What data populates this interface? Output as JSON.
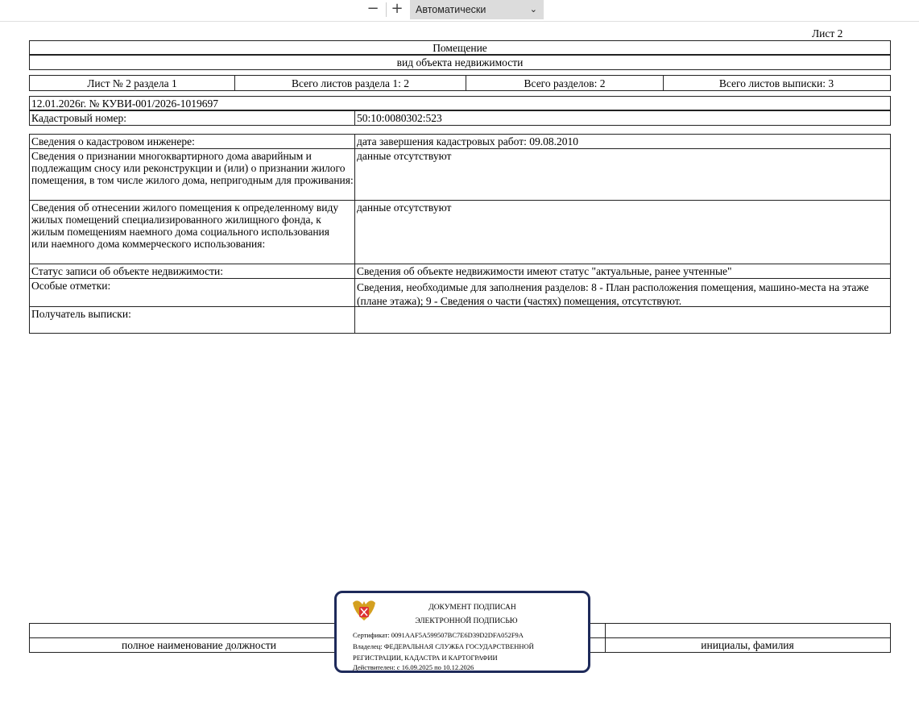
{
  "toolbar": {
    "zoom_out": "−",
    "zoom_in": "+",
    "zoom_value": "Автоматически"
  },
  "sheet_label": "Лист 2",
  "object_type": "Помещение",
  "object_type_caption": "вид объекта недвижимости",
  "sheet_info": [
    "Лист № 2 раздела 1",
    "Всего листов раздела 1: 2",
    "Всего разделов: 2",
    "Всего листов выписки: 3"
  ],
  "doc_ref": "12.01.2026г. № КУВИ-001/2026-1019697",
  "cadastral": {
    "label": "Кадастровый номер:",
    "value": "50:10:0080302:523"
  },
  "rows": [
    {
      "label": "Сведения о кадастровом инженере:",
      "value": "дата завершения кадастровых работ: 09.08.2010"
    },
    {
      "label": "Сведения о признании многоквартирного дома аварийным и подлежащим сносу или реконструкции и (или) о признании жилого помещения, в том числе жилого дома, непригодным для проживания:",
      "value": "данные отсутствуют"
    },
    {
      "label": "Сведения об отнесении жилого помещения к определенному виду жилых помещений специализированного жилищного фонда, к жилым помещениям наемного дома социального использования или наемного дома коммерческого использования:",
      "value": "данные отсутствуют"
    },
    {
      "label": "Статус записи об объекте недвижимости:",
      "value": "Сведения об объекте недвижимости имеют статус \"актуальные, ранее учтенные\""
    },
    {
      "label": "Особые отметки:",
      "value": "Сведения, необходимые для заполнения разделов: 8 - План расположения помещения, машино-места на этаже (плане этажа); 9 - Сведения о части (частях) помещения, отсутствуют."
    },
    {
      "label": "Получатель выписки:",
      "value": ""
    }
  ],
  "signature": {
    "position_caption": "полное наименование должности",
    "name_caption": "инициалы, фамилия"
  },
  "stamp": {
    "line1": "ДОКУМЕНТ ПОДПИСАН",
    "line2": "ЭЛЕКТРОННОЙ ПОДПИСЬЮ",
    "cert": "Сертификат: 0091AAF5A599507BC7E6D39D2DFA052F9A",
    "owner1": "Владелец: ФЕДЕРАЛЬНАЯ СЛУЖБА ГОСУДАРСТВЕННОЙ",
    "owner2": "РЕГИСТРАЦИИ, КАДАСТРА И КАРТОГРАФИИ",
    "valid": "Действителен: с 16.09.2025 по 10.12.2026"
  }
}
